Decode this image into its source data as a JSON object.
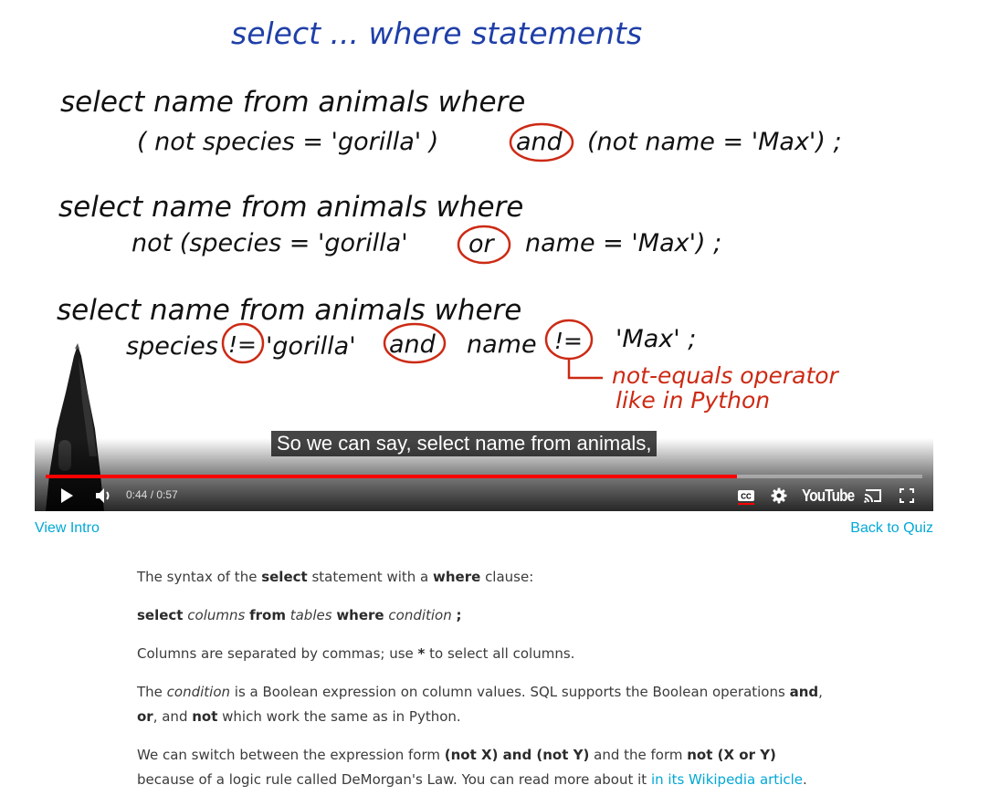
{
  "video": {
    "board": {
      "title": "select ... where statements",
      "q1_line1": "select name from animals where",
      "q1_line2": "( not species = 'gorilla' ) and (not name = 'Max') ;",
      "q1_p1": "( not  species  =  'gorilla' )",
      "q1_and": "and",
      "q1_p2": "(not  name = 'Max') ;",
      "q2_line1": "select name from animals where",
      "q2_p1": "not  (species  =  'gorilla'",
      "q2_or": "or",
      "q2_p2": "name  = 'Max') ;",
      "q3_line1": "select name from animals where",
      "q3_species": "species",
      "q3_ne1": "!=",
      "q3_gorilla": "'gorilla'",
      "q3_and": "and",
      "q3_name": "name",
      "q3_ne2": "!=",
      "q3_max": "'Max' ;",
      "note1": "not-equals operator",
      "note2": "like in Python"
    },
    "caption": "So we can say, select name from animals,",
    "player": {
      "current_time": "0:44",
      "duration": "0:57",
      "time_separator": " / ",
      "progress_fraction": 0.789,
      "brand_label": "YouTube",
      "accent_color": "#ff0000"
    },
    "icons": {
      "play": "play-icon",
      "volume": "volume-icon",
      "cc": "closed-captions-icon",
      "settings": "gear-icon",
      "cast": "cast-icon",
      "fullscreen": "fullscreen-icon"
    }
  },
  "nav": {
    "view_intro": "View Intro",
    "back_to_quiz": "Back to Quiz"
  },
  "article": {
    "p1": {
      "t1": "The syntax of the ",
      "b1": "select",
      "t2": " statement with a ",
      "b2": "where",
      "t3": " clause:"
    },
    "p2": {
      "b1": "select",
      "i1": "columns",
      "b2": "from",
      "i2": "tables",
      "b3": "where",
      "i3": "condition",
      "b4": ";"
    },
    "p3": {
      "t1": "Columns are separated by commas; use ",
      "b1": "*",
      "t2": " to select all columns."
    },
    "p4": {
      "t1": "The ",
      "i1": "condition",
      "t2": " is a Boolean expression on column values. SQL supports the Boolean operations ",
      "b1": "and",
      "t3": ",",
      "b2": "or",
      "t4": ", and ",
      "b3": "not",
      "t5": " which work the same as in Python."
    },
    "p5": {
      "t1": "We can switch between the expression form ",
      "b1": "(not X) and (not Y)",
      "t2": " and the form ",
      "b2": "not (X or Y)",
      "t3": " because of a logic rule called DeMorgan's Law. You can read more about it ",
      "link": "in its Wikipedia article",
      "t4": "."
    }
  }
}
